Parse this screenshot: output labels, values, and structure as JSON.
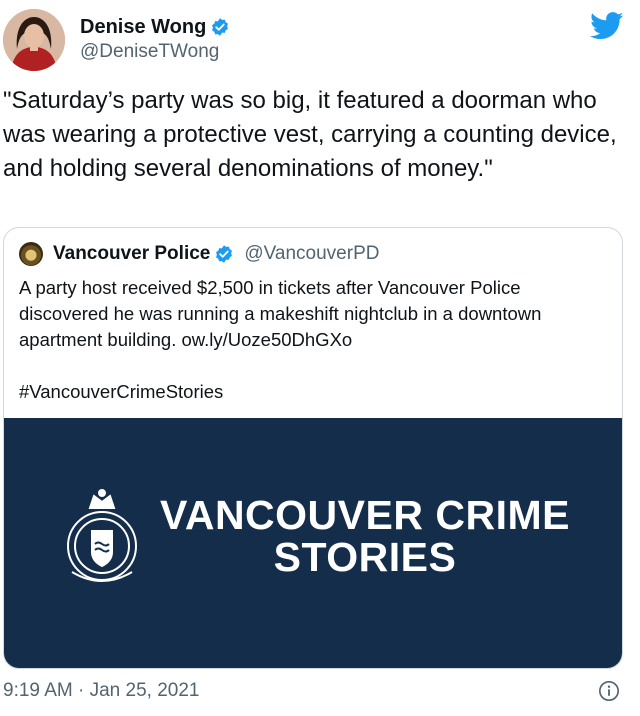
{
  "author": {
    "name": "Denise Wong",
    "handle": "@DeniseTWong",
    "avatar_icon": "avatar-photo",
    "verified": true
  },
  "tweet": {
    "text": "\"Saturday’s party was so big, it featured a doorman who was wearing a protective vest, carrying a counting device, and holding several denominations of money.\""
  },
  "quoted": {
    "name": "Vancouver Police",
    "handle": "@VancouverPD",
    "verified": true,
    "text_body": "A party host received $2,500 in tickets after Vancouver Police discovered he was running a makeshift nightclub in a downtown apartment building. ",
    "link": "ow.ly/Uoze50DhGXo",
    "hashtag": "#VancouverCrimeStories",
    "banner": {
      "title_line1": "VANCOUVER CRIME",
      "title_line2": "STORIES",
      "background": "#142d4a"
    }
  },
  "meta": {
    "time": "9:19 AM",
    "separator": " · ",
    "date": "Jan 25, 2021"
  },
  "colors": {
    "verified_blue": "#1d9bf0",
    "twitter_blue": "#1d9bf0",
    "secondary_text": "#536471",
    "border": "#cfd9de"
  },
  "icons": {
    "brand": "twitter-bird-icon",
    "verified": "verified-badge-icon",
    "info": "info-icon"
  }
}
